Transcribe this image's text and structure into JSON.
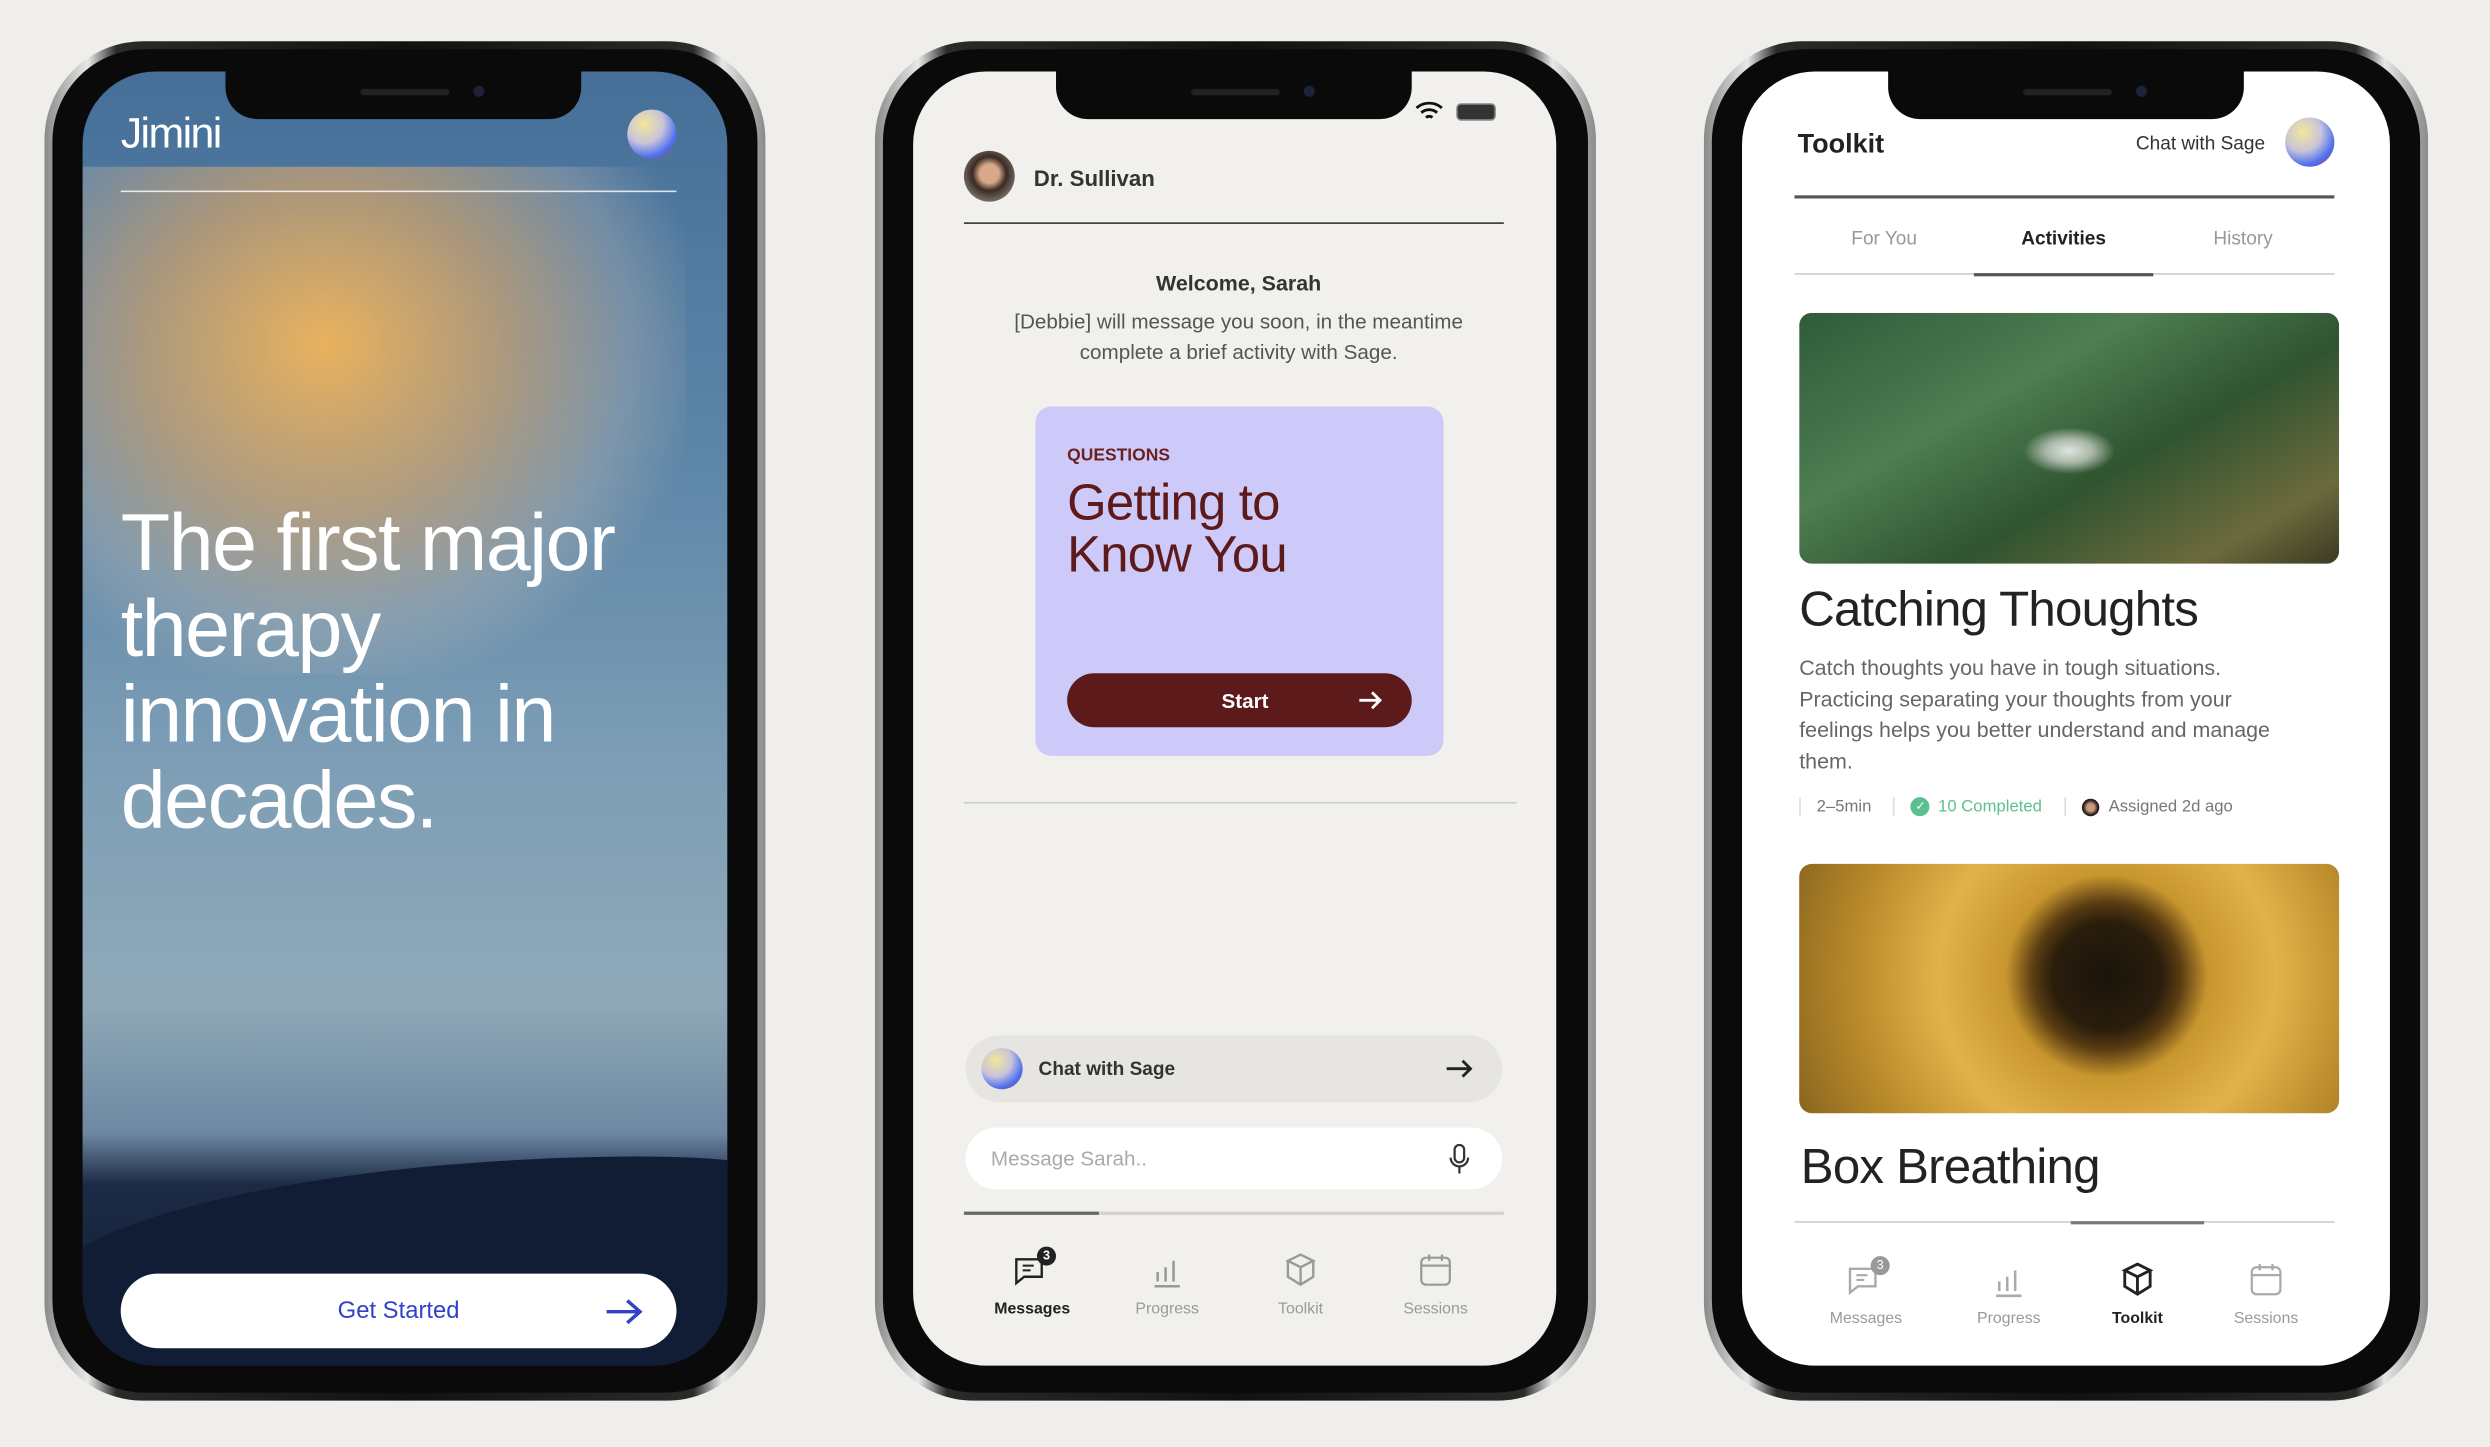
{
  "phone1": {
    "app_title": "Jimini",
    "headline_lines": [
      "The first major",
      "therapy",
      "innovation in",
      "decades."
    ],
    "cta_label": "Get Started",
    "colors": {
      "cta_text": "#3340c8"
    }
  },
  "phone2": {
    "therapist_name": "Dr. Sullivan",
    "welcome_title": "Welcome, Sarah",
    "welcome_lines": [
      "[Debbie] will message you soon, in the meantime",
      "complete a brief activity with Sage."
    ],
    "card": {
      "eyebrow": "QUESTIONS",
      "title_lines": [
        "Getting to",
        "Know You"
      ],
      "button_label": "Start"
    },
    "chat_with_sage": "Chat with Sage",
    "message_placeholder": "Message Sarah..",
    "nav": [
      {
        "label": "Messages",
        "icon": "message-icon",
        "badge": "3",
        "active": true
      },
      {
        "label": "Progress",
        "icon": "bar-chart-icon"
      },
      {
        "label": "Toolkit",
        "icon": "cube-icon"
      },
      {
        "label": "Sessions",
        "icon": "calendar-icon"
      }
    ],
    "colors": {
      "card_bg": "#cdcaf9",
      "accent": "#5c1a1a"
    }
  },
  "phone3": {
    "title": "Toolkit",
    "chat_with_sage": "Chat with Sage",
    "tabs": [
      {
        "label": "For You"
      },
      {
        "label": "Activities",
        "active": true
      },
      {
        "label": "History"
      }
    ],
    "activities": [
      {
        "title": "Catching Thoughts",
        "description_lines": [
          "Catch thoughts you have in tough situations.",
          "Practicing separating your thoughts from your",
          "feelings helps you better understand and manage",
          "them."
        ],
        "duration": "2–5min",
        "completed": "10 Completed",
        "assigned": "Assigned 2d ago"
      },
      {
        "title": "Box Breathing"
      }
    ],
    "nav": [
      {
        "label": "Messages",
        "icon": "message-icon",
        "badge": "3"
      },
      {
        "label": "Progress",
        "icon": "bar-chart-icon"
      },
      {
        "label": "Toolkit",
        "icon": "cube-icon",
        "active": true
      },
      {
        "label": "Sessions",
        "icon": "calendar-icon"
      }
    ],
    "colors": {
      "completed": "#5cc08e"
    }
  }
}
